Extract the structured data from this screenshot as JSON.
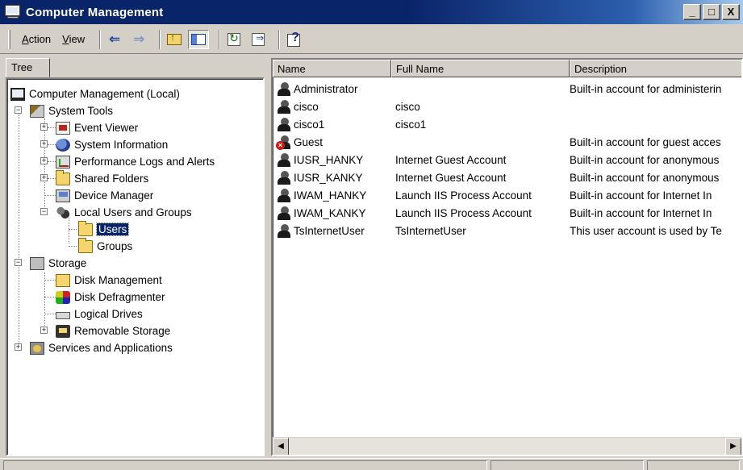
{
  "window": {
    "title": "Computer Management",
    "controls": {
      "minimize": "_",
      "maximize": "□",
      "close": "X"
    }
  },
  "menu": [
    {
      "label": "Action",
      "accel": "A",
      "rest": "ction"
    },
    {
      "label": "View",
      "accel": "V",
      "rest": "iew"
    }
  ],
  "toolbar": {
    "buttons": [
      "back-icon",
      "forward-icon",
      "up-one-level-icon",
      "show-hide-tree-icon",
      "refresh-icon",
      "export-list-icon",
      "help-icon"
    ],
    "back_glyph": "⇐",
    "forward_glyph": "⇒"
  },
  "tree": {
    "tab_label": "Tree",
    "items": [
      {
        "label": "Computer Management (Local)",
        "icon": "computer-icon"
      },
      {
        "label": "System Tools",
        "icon": "tools-icon",
        "expander": "−"
      },
      {
        "label": "Event Viewer",
        "icon": "event-viewer-icon",
        "expander": "+"
      },
      {
        "label": "System Information",
        "icon": "system-info-icon",
        "expander": "+"
      },
      {
        "label": "Performance Logs and Alerts",
        "icon": "performance-icon",
        "expander": "+"
      },
      {
        "label": "Shared Folders",
        "icon": "folder-icon",
        "expander": "+"
      },
      {
        "label": "Device Manager",
        "icon": "device-manager-icon"
      },
      {
        "label": "Local Users and Groups",
        "icon": "users-icon",
        "expander": "−"
      },
      {
        "label": "Users",
        "icon": "folder-icon",
        "selected": true
      },
      {
        "label": "Groups",
        "icon": "folder-icon"
      },
      {
        "label": "Storage",
        "icon": "storage-icon",
        "expander": "−"
      },
      {
        "label": "Disk Management",
        "icon": "disk-management-icon"
      },
      {
        "label": "Disk Defragmenter",
        "icon": "defragmenter-icon"
      },
      {
        "label": "Logical Drives",
        "icon": "drive-icon"
      },
      {
        "label": "Removable Storage",
        "icon": "removable-storage-icon",
        "expander": "+"
      },
      {
        "label": "Services and Applications",
        "icon": "services-icon",
        "expander": "+"
      }
    ]
  },
  "list": {
    "columns": [
      "Name",
      "Full Name",
      "Description"
    ],
    "rows": [
      {
        "name": "Administrator",
        "full_name": "",
        "description": "Built-in account for administerin",
        "disabled": false
      },
      {
        "name": "cisco",
        "full_name": "cisco",
        "description": "",
        "disabled": false
      },
      {
        "name": "cisco1",
        "full_name": "cisco1",
        "description": "",
        "disabled": false
      },
      {
        "name": "Guest",
        "full_name": "",
        "description": "Built-in account for guest acces",
        "disabled": true
      },
      {
        "name": "IUSR_HANKY",
        "full_name": "Internet Guest Account",
        "description": "Built-in account for anonymous",
        "disabled": false
      },
      {
        "name": "IUSR_KANKY",
        "full_name": "Internet Guest Account",
        "description": "Built-in account for anonymous",
        "disabled": false
      },
      {
        "name": "IWAM_HANKY",
        "full_name": "Launch IIS Process Account",
        "description": "Built-in account for Internet In",
        "disabled": false
      },
      {
        "name": "IWAM_KANKY",
        "full_name": "Launch IIS Process Account",
        "description": "Built-in account for Internet In",
        "disabled": false
      },
      {
        "name": "TsInternetUser",
        "full_name": "TsInternetUser",
        "description": "This user account is used by Te",
        "disabled": false
      }
    ]
  },
  "scrollbar": {
    "left_arrow": "◀",
    "right_arrow": "▶"
  }
}
